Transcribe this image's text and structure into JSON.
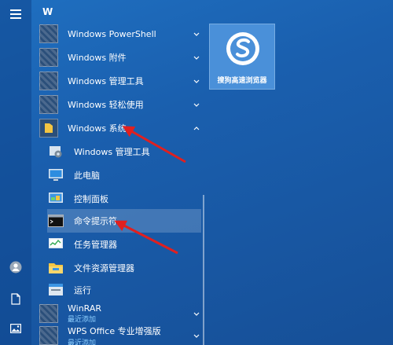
{
  "start_menu": {
    "section_letter": "W",
    "apps": [
      {
        "label": "Windows PowerShell"
      },
      {
        "label": "Windows 附件"
      },
      {
        "label": "Windows 管理工具"
      },
      {
        "label": "Windows 轻松使用"
      },
      {
        "label": "Windows 系统"
      }
    ],
    "system_items": [
      {
        "label": "Windows 管理工具",
        "icon": "admin-tools-icon"
      },
      {
        "label": "此电脑",
        "icon": "this-pc-icon"
      },
      {
        "label": "控制面板",
        "icon": "control-panel-icon"
      },
      {
        "label": "命令提示符",
        "icon": "command-prompt-icon"
      },
      {
        "label": "任务管理器",
        "icon": "task-manager-icon"
      },
      {
        "label": "文件资源管理器",
        "icon": "file-explorer-icon"
      },
      {
        "label": "运行",
        "icon": "run-icon"
      }
    ],
    "more_apps": [
      {
        "label": "WinRAR",
        "sublabel": "最近添加"
      },
      {
        "label": "WPS Office 专业增强版",
        "sublabel": "最近添加"
      }
    ]
  },
  "tile": {
    "label": "搜狗高速浏览器",
    "color": "#4a90d9"
  },
  "colors": {
    "accent": "#e02020",
    "highlight_row": "rgba(255,255,255,0.18)",
    "sublabel": "#8fd0ff"
  }
}
